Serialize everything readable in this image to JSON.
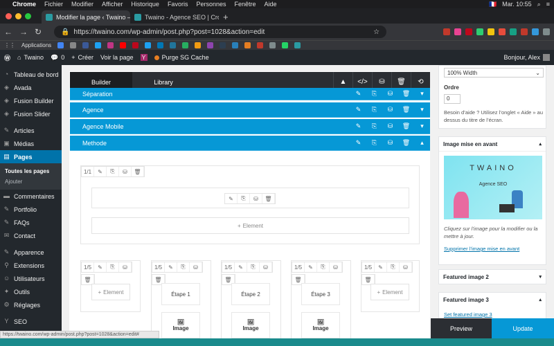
{
  "macbar": {
    "apple": "",
    "menus": [
      "Chrome",
      "Fichier",
      "Modifier",
      "Afficher",
      "Historique",
      "Favoris",
      "Personnes",
      "Fenêtre",
      "Aide"
    ],
    "datetime": "Mar. 10:55",
    "flag": "🇫🇷"
  },
  "tabs": [
    {
      "title": "Modifier la page ‹ Twaino — W",
      "close": "×"
    },
    {
      "title": "Twaino - Agence SEO | Croiss",
      "close": "×"
    }
  ],
  "newtab": "+",
  "address": {
    "url": "https://twaino.com/wp-admin/post.php?post=1028&action=edit"
  },
  "bookmarks": {
    "label": "Applications"
  },
  "wpadminbar": {
    "site": "Twaino",
    "comments": "0",
    "create": "Créer",
    "view": "Voir la page",
    "purge": "Purge SG Cache",
    "greeting": "Bonjour, Alex"
  },
  "sidebar": {
    "items": [
      {
        "label": "Tableau de bord",
        "icon": "dashboard-icon"
      },
      {
        "label": "Avada",
        "icon": "avada-icon"
      },
      {
        "label": "Fusion Builder",
        "icon": "fusion-builder-icon"
      },
      {
        "label": "Fusion Slider",
        "icon": "fusion-slider-icon"
      },
      {
        "label": "Articles",
        "icon": "pin-icon"
      },
      {
        "label": "Médias",
        "icon": "media-icon"
      },
      {
        "label": "Pages",
        "icon": "pages-icon"
      },
      {
        "label": "Commentaires",
        "icon": "comment-icon"
      },
      {
        "label": "Portfolio",
        "icon": "portfolio-icon"
      },
      {
        "label": "FAQs",
        "icon": "faq-icon"
      },
      {
        "label": "Contact",
        "icon": "contact-icon"
      },
      {
        "label": "Apparence",
        "icon": "appearance-icon"
      },
      {
        "label": "Extensions",
        "icon": "plugin-icon"
      },
      {
        "label": "Utilisateurs",
        "icon": "users-icon"
      },
      {
        "label": "Outils",
        "icon": "tools-icon"
      },
      {
        "label": "Réglages",
        "icon": "settings-icon"
      },
      {
        "label": "SEO",
        "icon": "seo-icon"
      }
    ],
    "sub": [
      "Toutes les pages",
      "Ajouter"
    ]
  },
  "builder": {
    "tabs": [
      "Builder",
      "Library"
    ],
    "containers": [
      "Séparation",
      "Agence",
      "Agence Mobile",
      "Methode"
    ],
    "col_full": "1/1",
    "col_fifth": "1/5",
    "element": "Element",
    "plus": "+",
    "etapes": [
      "Étape 1",
      "Étape 2",
      "Étape 3"
    ],
    "image": "Image"
  },
  "rpanel": {
    "width_select": "100% Width",
    "order_label": "Ordre",
    "order_value": "0",
    "help": "Besoin d’aide ? Utilisez l’onglet « Aide » au dessus du titre de l’écran.",
    "featured_title": "Image mise en avant",
    "thumb_brand": "TWAINO",
    "thumb_sub": "Agence SEO",
    "click_text": "Cliquez sur l’image pour la modifier ou la mettre à jour.",
    "remove_link": "Supprimer l’image mise en avant",
    "featured2": "Featured image 2",
    "featured3": "Featured image 3",
    "set3": "Set featured image 3"
  },
  "footer": {
    "preview": "Preview",
    "update": "Update"
  },
  "statusbar": "https://twaino.com/wp-admin/post.php?post=1028&action=edit#",
  "colors": {
    "accent": "#0698d6",
    "wp_dark": "#23282d",
    "builder_dark": "#2b2e33"
  }
}
